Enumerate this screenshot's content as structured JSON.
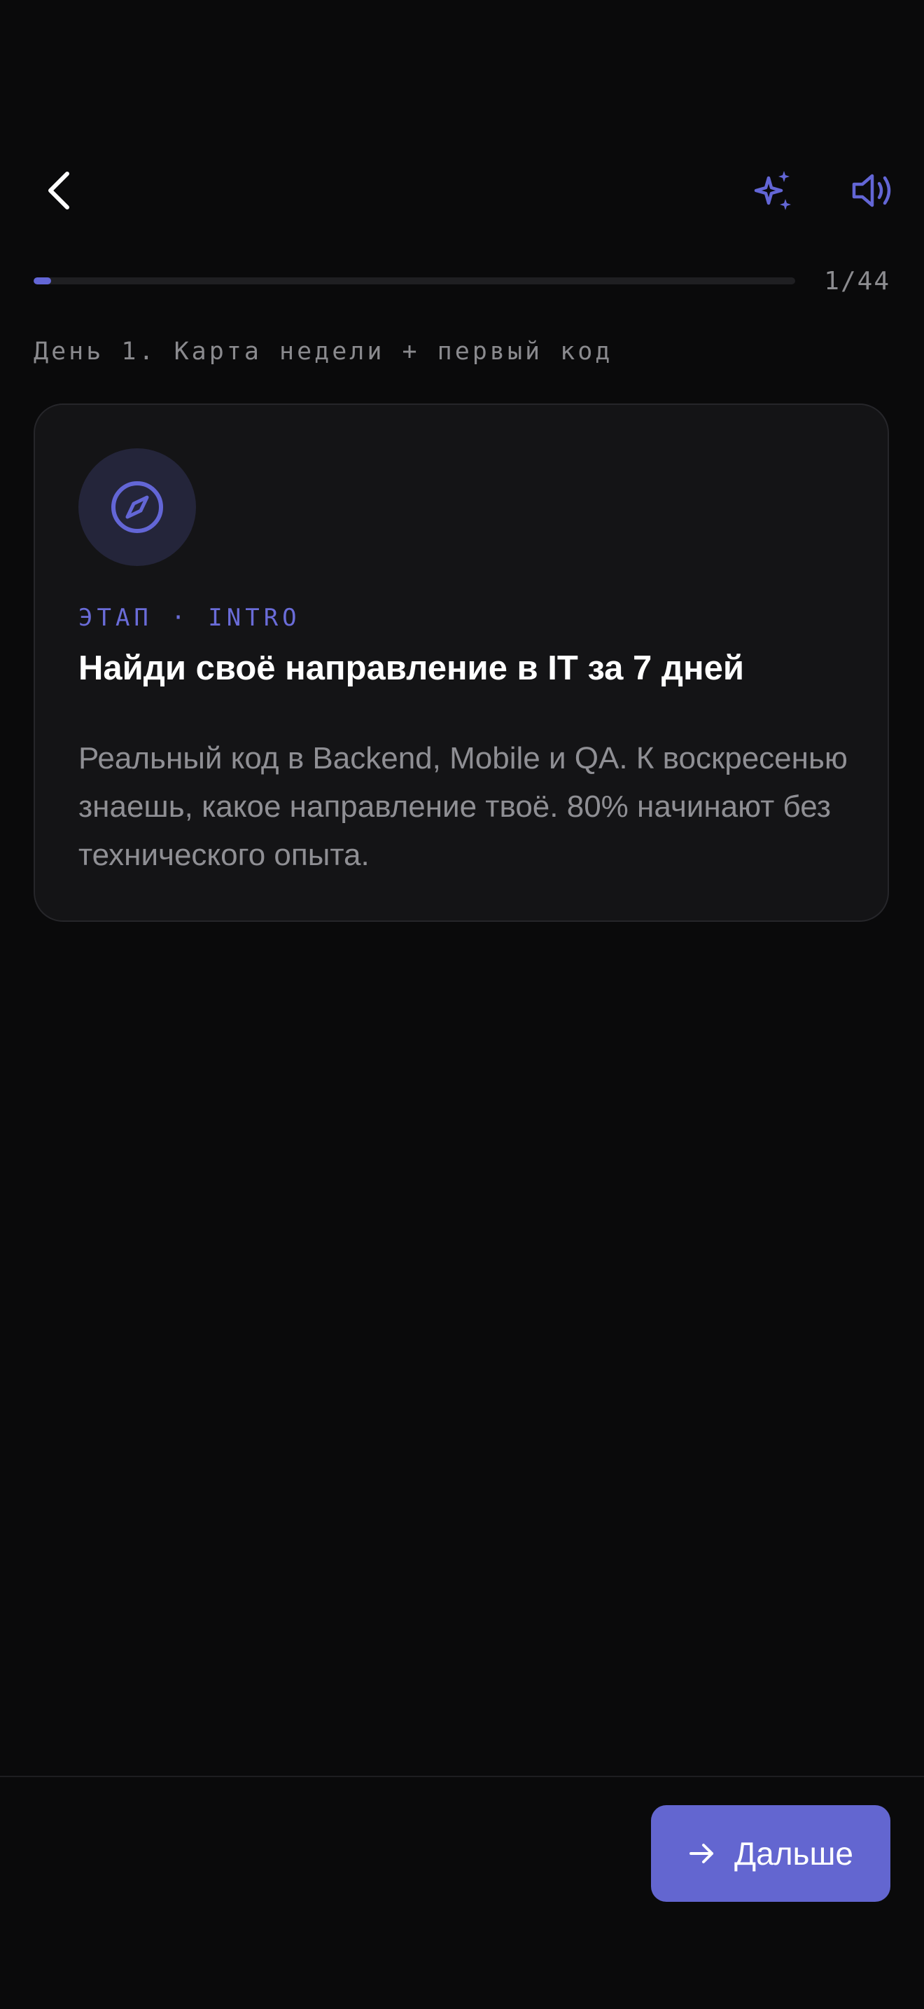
{
  "header": {
    "back_icon": "chevron-left-icon",
    "sparkle_icon": "sparkles-icon",
    "sound_icon": "speaker-icon",
    "accent_color": "#6366d6"
  },
  "progress": {
    "current": 1,
    "total": 44,
    "counter_text": "1/44",
    "fraction": 0.0227
  },
  "lesson": {
    "day_title": "День 1. Карта недели + первый код"
  },
  "card": {
    "icon": "compass-icon",
    "stage_label": "ЭТАП · INTRO",
    "title": "Найди своё направление в IT за 7 дней",
    "description": "Реальный код в Backend, Mobile и QA. К воскресенью знаешь, какое направление твоё. 80% начинают без технического опыта."
  },
  "footer": {
    "next_label": "Дальше",
    "next_icon": "arrow-right-icon"
  }
}
